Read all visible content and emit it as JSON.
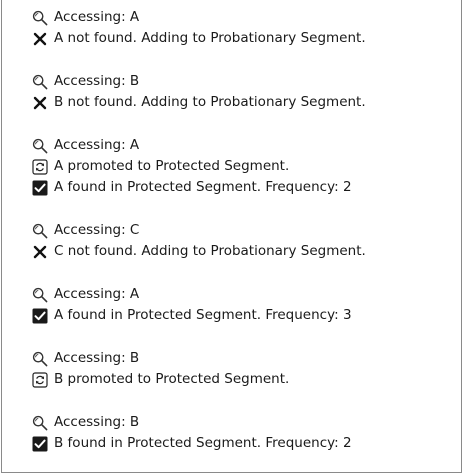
{
  "log": {
    "groups": [
      {
        "lines": [
          {
            "icon": "magnifier-icon",
            "text": "Accessing: A"
          },
          {
            "icon": "cross-icon",
            "text": "A not found. Adding to Probationary Segment."
          }
        ]
      },
      {
        "lines": [
          {
            "icon": "magnifier-icon",
            "text": "Accessing: B"
          },
          {
            "icon": "cross-icon",
            "text": "B not found. Adding to Probationary Segment."
          }
        ]
      },
      {
        "lines": [
          {
            "icon": "magnifier-icon",
            "text": "Accessing: A"
          },
          {
            "icon": "refresh-icon",
            "text": "A promoted to Protected Segment."
          },
          {
            "icon": "checkbox-checked-icon",
            "text": "A found in Protected Segment. Frequency: 2"
          }
        ]
      },
      {
        "lines": [
          {
            "icon": "magnifier-icon",
            "text": "Accessing: C"
          },
          {
            "icon": "cross-icon",
            "text": "C not found. Adding to Probationary Segment."
          }
        ]
      },
      {
        "lines": [
          {
            "icon": "magnifier-icon",
            "text": "Accessing: A"
          },
          {
            "icon": "checkbox-checked-icon",
            "text": "A found in Protected Segment. Frequency: 3"
          }
        ]
      },
      {
        "lines": [
          {
            "icon": "magnifier-icon",
            "text": "Accessing: B"
          },
          {
            "icon": "refresh-icon",
            "text": "B promoted to Protected Segment."
          }
        ]
      },
      {
        "lines": [
          {
            "icon": "magnifier-icon",
            "text": "Accessing: B"
          },
          {
            "icon": "checkbox-checked-icon",
            "text": "B found in Protected Segment. Frequency: 2"
          }
        ]
      }
    ]
  }
}
